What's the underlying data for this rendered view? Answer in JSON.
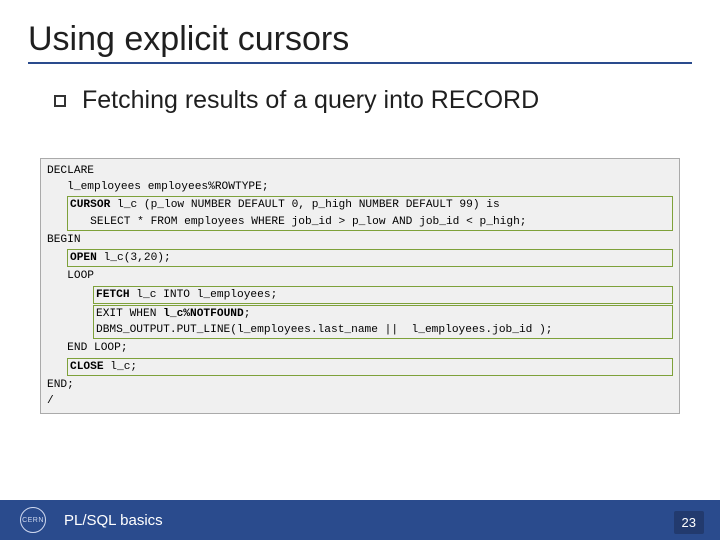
{
  "title": "Using explicit cursors",
  "bullet": "Fetching  results of a query into RECORD",
  "code": {
    "declare": "DECLARE",
    "l_employees": "   l_employees employees%ROWTYPE;",
    "cursor_def1": "CURSOR l_c (p_low NUMBER DEFAULT 0, p_high NUMBER DEFAULT 99) is",
    "cursor_def2": "   SELECT * FROM employees WHERE job_id > p_low AND job_id < p_high;",
    "begin": "BEGIN",
    "open": "OPEN l_c(3,20);",
    "loop": "   LOOP",
    "fetch": "FETCH l_c INTO l_employees;",
    "exit": "      EXIT WHEN l_c%NOTFOUND;",
    "dbms": "      DBMS_OUTPUT.PUT_LINE(l_employees.last_name ||  l_employees.job_id );",
    "endloop": "   END LOOP;",
    "close": "CLOSE l_c;",
    "end": "END;",
    "slash": "/"
  },
  "footer": {
    "text": "PL/SQL basics",
    "page": "23",
    "logo": "CERN"
  }
}
